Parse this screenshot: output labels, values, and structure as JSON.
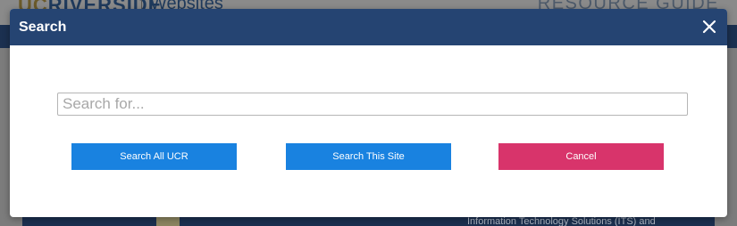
{
  "background": {
    "logo_prefix": "UC",
    "logo_text": "RIVERSIDE",
    "websites_label": "Websites",
    "resource_guide_label": "RESOURCE GUIDE",
    "content_text": "Information Technology Solutions (ITS) and"
  },
  "modal": {
    "title": "Search",
    "close_icon": "close-icon",
    "search_placeholder": "Search for...",
    "search_value": "",
    "buttons": {
      "search_all": "Search All UCR",
      "search_site": "Search This Site",
      "cancel": "Cancel"
    }
  },
  "colors": {
    "header_bg": "#254472",
    "primary_button": "#1982e0",
    "cancel_button": "#d8346b",
    "overlay": "#7c7c7c"
  }
}
